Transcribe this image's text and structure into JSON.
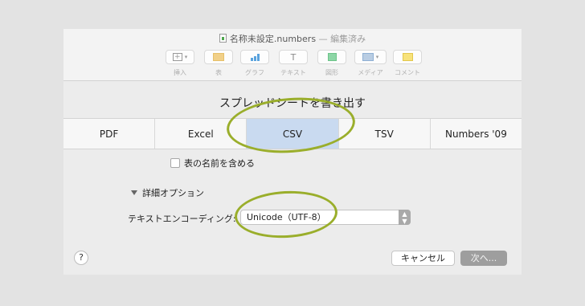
{
  "window": {
    "filename": "名称未設定.numbers",
    "status": "— 編集済み"
  },
  "toolbar": {
    "items": [
      {
        "label": "挿入",
        "icon": "insert-icon"
      },
      {
        "label": "表",
        "icon": "table-icon"
      },
      {
        "label": "グラフ",
        "icon": "chart-icon"
      },
      {
        "label": "テキスト",
        "icon": "text-icon"
      },
      {
        "label": "図形",
        "icon": "shape-icon"
      },
      {
        "label": "メディア",
        "icon": "media-icon"
      },
      {
        "label": "コメント",
        "icon": "comment-icon"
      }
    ]
  },
  "sheet": {
    "title": "スプレッドシートを書き出す",
    "tabs": [
      "PDF",
      "Excel",
      "CSV",
      "TSV",
      "Numbers '09"
    ],
    "selected_tab": "CSV",
    "include_table_names": "表の名前を含める",
    "advanced_options": "詳細オプション",
    "encoding_label": "テキストエンコーディング:",
    "encoding_value": "Unicode（UTF-8）",
    "help": "?",
    "cancel": "キャンセル",
    "next": "次へ..."
  },
  "colors": {
    "highlight": "#9aae2b",
    "selected_tab": "#c9daf0"
  }
}
